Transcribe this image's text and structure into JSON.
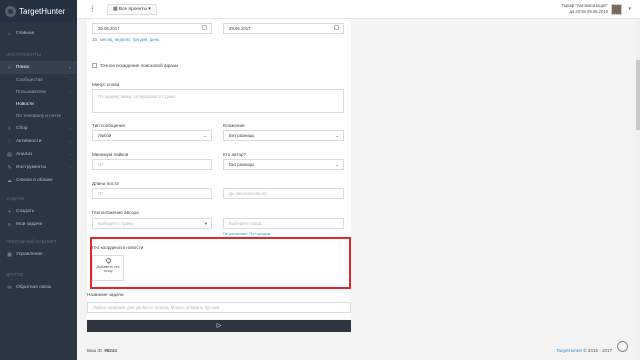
{
  "app": {
    "logo_text": "TargetHunter"
  },
  "sidebar": {
    "main": "Главная",
    "section_tools": "Инструменты",
    "search": "Поиск",
    "sub": [
      "Сообщества",
      "Пользователи",
      "Новости",
      "По телефону и почте"
    ],
    "items": [
      {
        "label": "Сбор",
        "icon": "download-icon"
      },
      {
        "label": "Активности",
        "icon": "activity-icon"
      },
      {
        "label": "Анализ",
        "icon": "chart-icon"
      },
      {
        "label": "Инструменты",
        "icon": "tools-icon"
      },
      {
        "label": "Списки в облаке",
        "icon": "cloud-icon"
      }
    ],
    "section_tasks": "Задачи",
    "tasks": [
      {
        "label": "Создать",
        "icon": "plus-icon"
      },
      {
        "label": "Мои задачи",
        "icon": "tasks-icon"
      }
    ],
    "section_ads": "Рекламный кабинет",
    "ads": {
      "label": "Управление",
      "icon": "manage-icon"
    },
    "section_other": "Другое",
    "other": {
      "label": "Обратная связь",
      "icon": "feedback-icon"
    }
  },
  "topbar": {
    "projects": "Все проекты",
    "tariff_line1": "Тариф \"Автоматизация\"",
    "tariff_line2": "до 23:59 09.06.2018"
  },
  "form": {
    "date_from": "29.05.2017",
    "date_to": "29.06.2017",
    "period_prefix": "За",
    "period_links": "месяц, неделю, три дня, день",
    "exact_phrase": "Точное вхождение поисковой фразы",
    "minus_words_label": "Минус слова",
    "minus_words_placeholder": "По одному минус словуфразе в строке",
    "msg_type_label": "Тип сообщения",
    "msg_type_value": "Любой",
    "attachments_label": "Вложения",
    "attachments_value": "Без разницы",
    "min_likes_label": "Минимум лайков",
    "min_likes_placeholder": "От",
    "author_label": "Кто автор?",
    "author_value": "Без разницы",
    "post_length_label": "Длина поста",
    "post_length_from": "От",
    "post_length_to": "До (включительно)",
    "geo_label": "Геоположение автора",
    "country_placeholder": "Выберите страну...",
    "city_placeholder": "Выберите город...",
    "geo_hint": "По регионам / По городам",
    "geo_news_label": "Гео координата новости",
    "add_point": "Добавить гео точку",
    "task_name_label": "Название задачи",
    "task_name_placeholder": "Любое название для удобного поиска. Можно оставить пустым."
  },
  "footer": {
    "id_prefix": "Ваш ID:",
    "id_value": "98243",
    "brand": "TargetHunter",
    "copyright": "© 2015 - 2017"
  },
  "colors": {
    "accent": "#3b8ed4",
    "highlight": "#e1282d",
    "sidebar": "#2b3643"
  }
}
